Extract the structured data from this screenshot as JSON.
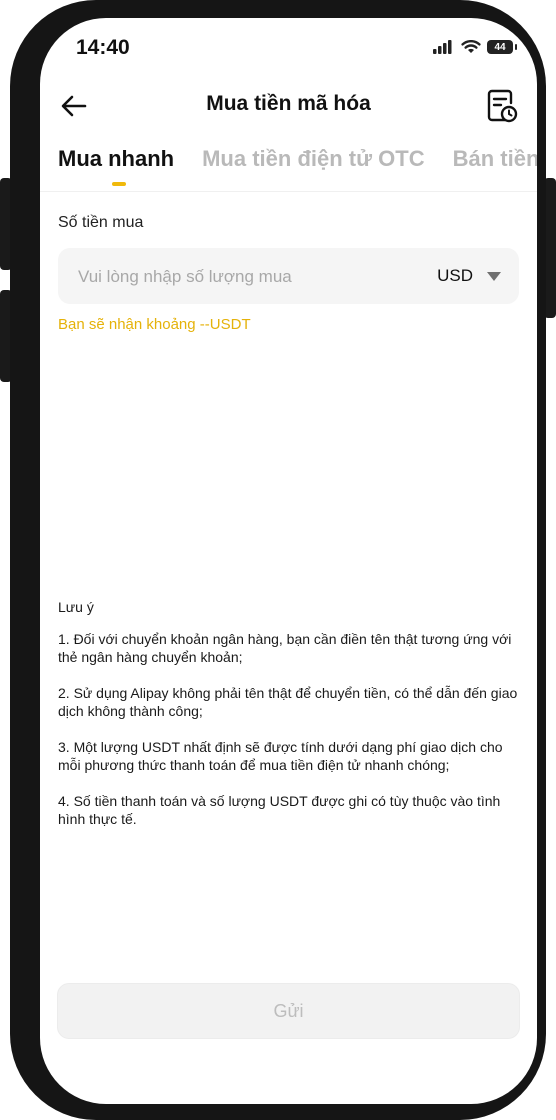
{
  "status_bar": {
    "time": "14:40",
    "battery": "44",
    "icons": [
      "signal-icon",
      "wifi-icon",
      "battery-icon"
    ]
  },
  "header": {
    "title": "Mua tiền mã hóa",
    "back_icon": "arrow-left-icon",
    "history_icon": "order-history-icon"
  },
  "tabs": [
    {
      "label": "Mua nhanh",
      "active": true
    },
    {
      "label": "Mua tiền điện tử OTC",
      "active": false
    },
    {
      "label": "Bán tiền",
      "active": false
    }
  ],
  "form": {
    "amount_label": "Số tiền mua",
    "amount_placeholder": "Vui lòng nhập số lượng mua",
    "amount_value": "",
    "currency": "USD",
    "receive_hint": "Bạn sẽ nhận khoảng --USDT"
  },
  "notes": {
    "title": "Lưu ý",
    "items": [
      "1. Đối với chuyển khoản ngân hàng, bạn cần điền tên thật tương ứng với thẻ ngân hàng chuyển khoản;",
      "2. Sử dụng Alipay không phải tên thật để chuyển tiền, có thể dẫn đến giao dịch không thành công;",
      "3. Một lượng USDT nhất định sẽ được tính dưới dạng phí giao dịch cho mỗi phương thức thanh toán để mua tiền điện tử nhanh chóng;",
      "4. Số tiền thanh toán và số lượng USDT được ghi có tùy thuộc vào tình hình thực tế."
    ]
  },
  "submit": {
    "label": "Gửi",
    "enabled": false
  },
  "colors": {
    "accent": "#f0b90b",
    "hint": "#e5b20a",
    "inactive_tab": "#b9b9b9",
    "disabled_button_text": "#bdbdbd"
  }
}
